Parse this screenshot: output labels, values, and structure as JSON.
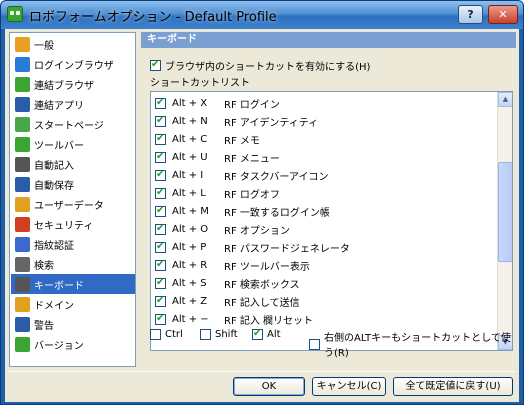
{
  "window": {
    "title": "ロボフォームオプション - Default Profile",
    "help_label": "?",
    "close_label": "✕"
  },
  "sidebar": {
    "items": [
      {
        "label": "一般",
        "icon": "gear-icon",
        "color": "#e8a020"
      },
      {
        "label": "ログインブラウザ",
        "icon": "globe-icon",
        "color": "#2a7bd6"
      },
      {
        "label": "連結ブラウザ",
        "icon": "puzzle-icon",
        "color": "#3aa531"
      },
      {
        "label": "連結アプリ",
        "icon": "app-window-icon",
        "color": "#2a5caa"
      },
      {
        "label": "スタートページ",
        "icon": "home-icon",
        "color": "#4aa64a"
      },
      {
        "label": "ツールバー",
        "icon": "toolbar-icon",
        "color": "#3aa531"
      },
      {
        "label": "自動記入",
        "icon": "keyboard-icon",
        "color": "#555555"
      },
      {
        "label": "自動保存",
        "icon": "save-icon",
        "color": "#2a5caa"
      },
      {
        "label": "ユーザーデータ",
        "icon": "user-data-icon",
        "color": "#e0a020"
      },
      {
        "label": "セキュリティ",
        "icon": "security-icon",
        "color": "#d04020"
      },
      {
        "label": "指紋認証",
        "icon": "fingerprint-icon",
        "color": "#3a6ad0"
      },
      {
        "label": "検索",
        "icon": "search-icon",
        "color": "#666666"
      },
      {
        "label": "キーボード",
        "icon": "keyboard-shortcut-icon",
        "color": "#555555",
        "selected": true
      },
      {
        "label": "ドメイン",
        "icon": "domain-icon",
        "color": "#e0a020"
      },
      {
        "label": "警告",
        "icon": "warning-checkbox-icon",
        "color": "#2a5caa"
      },
      {
        "label": "バージョン",
        "icon": "roboform-icon",
        "color": "#3aa531"
      }
    ]
  },
  "panel": {
    "header": "キーボード",
    "enable_label": "ブラウザ内のショートカットを有効にする(H)",
    "enable_checked": true,
    "list_caption": "ショートカットリスト"
  },
  "shortcuts": [
    {
      "key": "Alt + X",
      "action": "RF ログイン",
      "checked": true
    },
    {
      "key": "Alt + N",
      "action": "RF アイデンティティ",
      "checked": true
    },
    {
      "key": "Alt + C",
      "action": "RF メモ",
      "checked": true
    },
    {
      "key": "Alt + U",
      "action": "RF メニュー",
      "checked": true
    },
    {
      "key": "Alt + I",
      "action": "RF タスクバーアイコン",
      "checked": true
    },
    {
      "key": "Alt + L",
      "action": "RF ログオフ",
      "checked": true
    },
    {
      "key": "Alt + M",
      "action": "RF 一致するログイン帳",
      "checked": true
    },
    {
      "key": "Alt + O",
      "action": "RF オプション",
      "checked": true
    },
    {
      "key": "Alt + P",
      "action": "RF パスワードジェネレータ",
      "checked": true
    },
    {
      "key": "Alt + R",
      "action": "RF ツールバー表示",
      "checked": true
    },
    {
      "key": "Alt + S",
      "action": "RF 検索ボックス",
      "checked": true
    },
    {
      "key": "Alt + Z",
      "action": "RF 記入して送信",
      "checked": true
    },
    {
      "key": "Alt + −",
      "action": "RF 記入 欄リセット",
      "checked": true
    }
  ],
  "modifiers": {
    "ctrl_label": "Ctrl",
    "ctrl_checked": false,
    "shift_label": "Shift",
    "shift_checked": false,
    "alt_label": "Alt",
    "alt_checked": true,
    "right_alt_label": "右側のALTキーもショートカットとして使う(R)",
    "right_alt_checked": false
  },
  "buttons": {
    "ok": "OK",
    "cancel": "キャンセル(C)",
    "reset": "全て既定値に戻す(U)"
  }
}
